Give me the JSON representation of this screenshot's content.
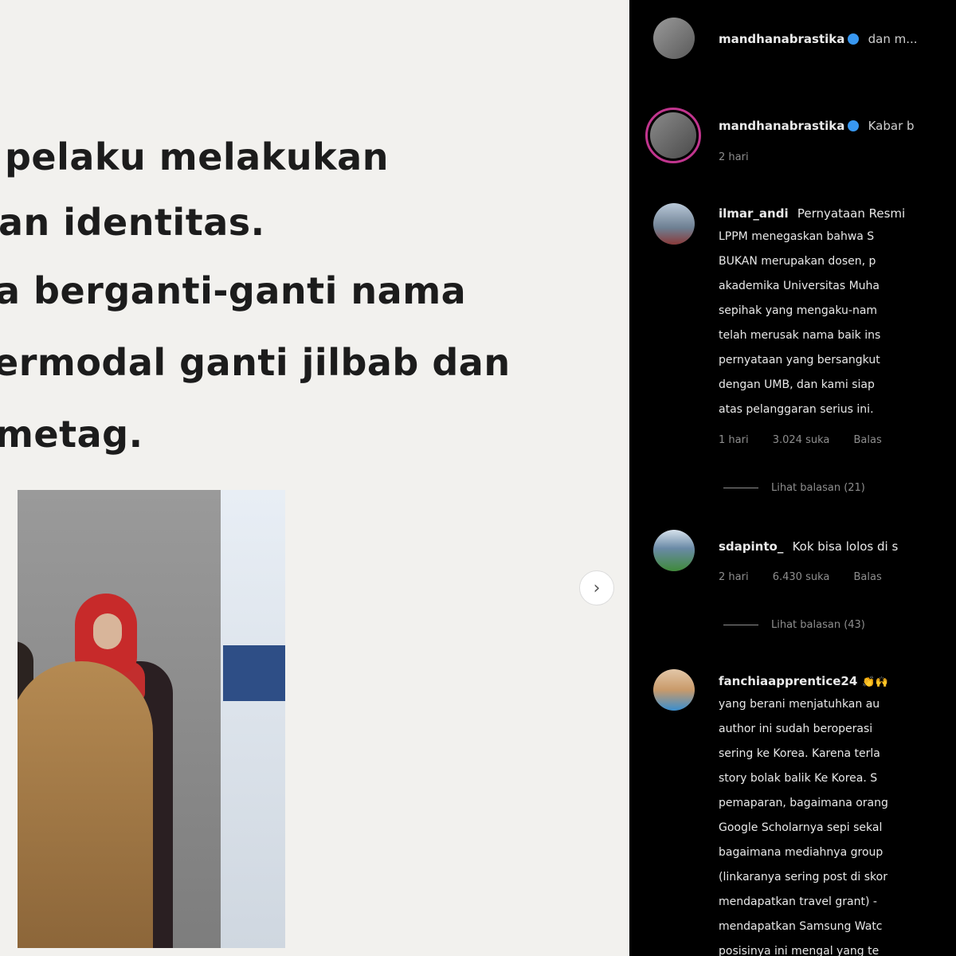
{
  "post": {
    "caption_lines": [
      "pelaku melakukan",
      "an identitas.",
      "a berganti-ganti nama",
      "ermodal ganti jilbab dan",
      "metag."
    ]
  },
  "navigation": {
    "next_icon": "chevron-right-icon",
    "next_glyph": "›"
  },
  "comments": {
    "header": {
      "username": "mandhanabrastika",
      "suffix": "dan m..."
    },
    "caption": {
      "username": "mandhanabrastika",
      "text": "Kabar b",
      "time": "2 hari"
    },
    "items": [
      {
        "username": "ilmar_andi",
        "text_first": "Pernyataan Resmi",
        "lines": [
          "LPPM menegaskan bahwa S",
          "BUKAN merupakan dosen, p",
          "akademika Universitas Muha",
          "sepihak yang mengaku-nam",
          "telah merusak nama baik ins",
          "pernyataan yang bersangkut",
          "dengan UMB, dan kami siap",
          "atas pelanggaran serius ini."
        ],
        "time": "1 hari",
        "likes": "3.024 suka",
        "reply": "Balas",
        "view_replies": "Lihat balasan (21)"
      },
      {
        "username": "sdapinto_",
        "text_first": "Kok bisa lolos di s",
        "lines": [],
        "time": "2 hari",
        "likes": "6.430 suka",
        "reply": "Balas",
        "view_replies": "Lihat balasan (43)"
      },
      {
        "username": "fanchiaapprentice24",
        "text_first": "",
        "emoji": "👏🙌",
        "lines": [
          "yang berani menjatuhkan au",
          "author ini sudah beroperasi",
          "sering ke Korea. Karena terla",
          "story bolak balik Ke Korea. S",
          "pemaparan, bagaimana orang",
          "Google Scholarnya sepi sekal",
          "bagaimana mediahnya group",
          "(linkaranya sering post di skor",
          "mendapatkan travel grant) -",
          "mendapatkan Samsung Watc",
          "posisinya ini mengal yang te"
        ]
      }
    ]
  },
  "colors": {
    "panel_bg": "#000000",
    "post_bg": "#f2f1ee",
    "verified": "#3897f0",
    "story_ring": "#c1358e"
  }
}
